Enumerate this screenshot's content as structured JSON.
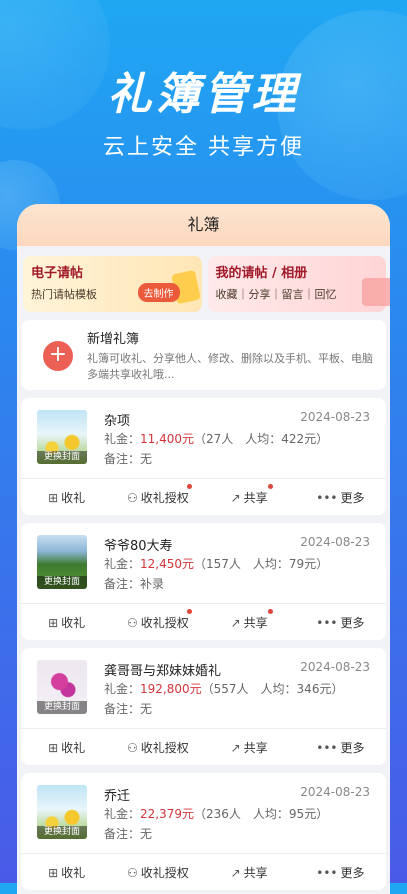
{
  "hero": {
    "title": "礼簿管理",
    "subtitle": "云上安全 共享方便"
  },
  "header": {
    "title": "礼簿"
  },
  "promos": [
    {
      "title": "电子请帖",
      "desc": "热门请帖模板",
      "button": "去制作"
    },
    {
      "title": "我的请帖 / 相册",
      "desc": "收藏｜分享｜留言｜回忆"
    }
  ],
  "new_book": {
    "title": "新增礼簿",
    "desc": "礼簿可收礼、分享他人、修改、删除以及手机、平板、电脑多端共享收礼哦..."
  },
  "actions": {
    "receive": "收礼",
    "authorize": "收礼授权",
    "share": "共享",
    "more": "更多"
  },
  "books": [
    {
      "name": "杂项",
      "date": "2024-08-23",
      "gift_label": "礼金：",
      "amount": "11,400元",
      "stats": "（27人　人均：422元）",
      "note": "备注：无",
      "cover_caption": "更换封面"
    },
    {
      "name": "爷爷80大寿",
      "date": "2024-08-23",
      "gift_label": "礼金：",
      "amount": "12,450元",
      "stats": "（157人　人均：79元）",
      "note": "备注：补录",
      "cover_caption": "更换封面"
    },
    {
      "name": "龚哥哥与郑妹妹婚礼",
      "date": "2024-08-23",
      "gift_label": "礼金：",
      "amount": "192,800元",
      "stats": "（557人　人均：346元）",
      "note": "备注：无",
      "cover_caption": "更换封面"
    },
    {
      "name": "乔迁",
      "date": "2024-08-23",
      "gift_label": "礼金：",
      "amount": "22,379元",
      "stats": "（236人　人均：95元）",
      "note": "备注：无",
      "cover_caption": "更换封面"
    }
  ],
  "colors": {
    "accent": "#d2363a",
    "plus": "#ec5f55",
    "header_bg": "#fcd8bf",
    "bg_top": "#1fa7f2",
    "bg_bottom": "#4a5ae8"
  }
}
